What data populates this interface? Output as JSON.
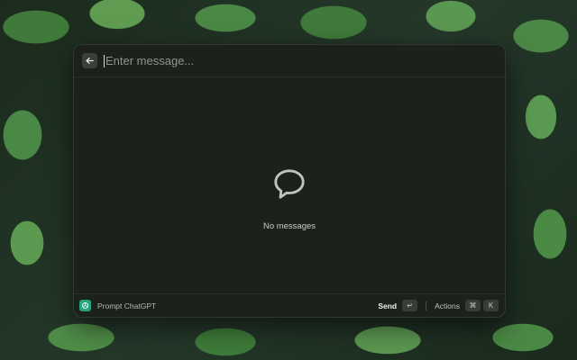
{
  "search": {
    "placeholder": "Enter message...",
    "value": ""
  },
  "empty_state": {
    "icon": "speech-bubble-icon",
    "text": "No messages"
  },
  "footer": {
    "title": "Prompt ChatGPT",
    "app_icon": "chatgpt-logo-icon",
    "send_label": "Send",
    "send_key": "↵",
    "actions_label": "Actions",
    "actions_key_1": "⌘",
    "actions_key_2": "K"
  },
  "colors": {
    "app_icon_bg": "#25a37f",
    "window_bg": "#1c211c"
  }
}
